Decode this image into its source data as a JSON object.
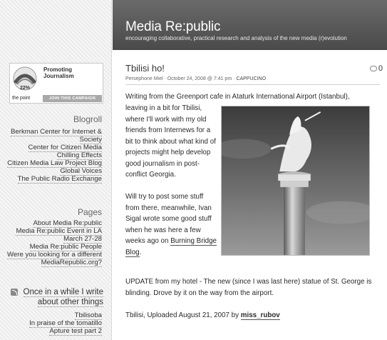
{
  "header": {
    "title": "Media Re:public",
    "tagline": "encouraging collaborative, practical research and analysis of the new media (r)evolution"
  },
  "campaign": {
    "title": "Promoting Journalism",
    "percent": "22%",
    "brand": "the point",
    "join_label": "JOIN THIS CAMPAIGN"
  },
  "sidebar": {
    "blogroll_heading": "Blogroll",
    "blogroll": [
      "Berkman Center for Internet & Society",
      "Center for Citizen Media",
      "Chilling Effects",
      "Citizen Media Law Project Blog",
      "Global Voices",
      "The Public Radio Exchange"
    ],
    "pages_heading": "Pages",
    "pages": [
      "About Media Re:public",
      "Media Re:public Event in LA March 27-28",
      "Media Re:public People",
      "Were you looking for a different MediaRepublic.org?"
    ],
    "other_heading": "Once in a while I write about other things",
    "other": [
      "Tbilisoba",
      "In praise of the tomatillo",
      "Apture test part 2"
    ]
  },
  "post": {
    "title": "Tbilisi ho!",
    "comment_count": "0",
    "meta_author": "Persephone Miel",
    "meta_sep1": " · ",
    "meta_date": "October 24, 2008 @ 7:41 pm",
    "meta_sep2": " · ",
    "meta_category": "CAPPUCINO",
    "p1_line1": "Writing from the Greenport cafe in Ataturk International Airport (Istanbul),",
    "p1_rest": "leaving in a bit for Tbilisi, where I'll work with my old friends from Internews for a bit to think about what kind of projects might help develop good journalism in post-conflict Georgia.",
    "p2_text": "Will try to post some stuff from there, meanwhile, Ivan Sigal wrote some good stuff when he was here a few weeks ago on ",
    "p2_link": "Burning Bridge Blog",
    "p2_end": ".",
    "p3": "UPDATE from my hotel - The new (since I was last here) statue of St. George is blinding. Drove by it on the way from the airport.",
    "p4_text": "Tbilisi, Uploaded August 21, 2007 by ",
    "p4_author": "miss_rubov"
  },
  "colors": {
    "header_bg": "#555555",
    "sidebar_bg": "#f0f0f0",
    "join_button": "#a9a9a9"
  },
  "icons": [
    "feed-icon",
    "comment-bubble-icon",
    "campaign-badge-icon"
  ]
}
